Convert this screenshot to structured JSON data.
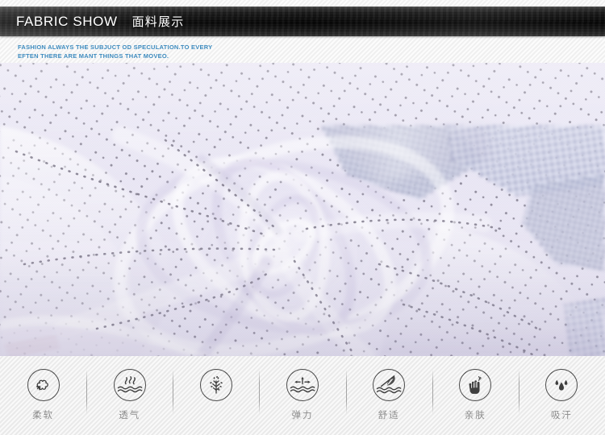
{
  "header": {
    "title_en": "FABRIC SHOW",
    "title_cn": "面料展示",
    "subtitle_line1": "FASHION ALWAYS THE  SUBJUCT OD SPECULATION.TO EVERY",
    "subtitle_line2": "EFTEN THERE ARE MANT THINGS THAT MOVEO.",
    "bar_color": "#000000",
    "subtitle_color": "#3d8bbf"
  },
  "photo": {
    "alt": "fabric-swirl-photo",
    "base_color": "#e8e5f2",
    "accent_blue": "#2a3f8f",
    "dot_color": "#6e6a80"
  },
  "features": {
    "items": [
      {
        "label": "柔软",
        "icon": "cotton-ball-icon"
      },
      {
        "label": "透气",
        "icon": "breathable-vapor-icon"
      },
      {
        "label": "",
        "icon": "plant-tree-icon"
      },
      {
        "label": "弹力",
        "icon": "elastic-arrows-icon"
      },
      {
        "label": "舒适",
        "icon": "feather-icon"
      },
      {
        "label": "亲肤",
        "icon": "hand-touch-icon"
      },
      {
        "label": "吸汗",
        "icon": "sweat-droplets-icon"
      }
    ],
    "label_color": "#8c8c8c",
    "ring_color": "#4a4a4a"
  }
}
